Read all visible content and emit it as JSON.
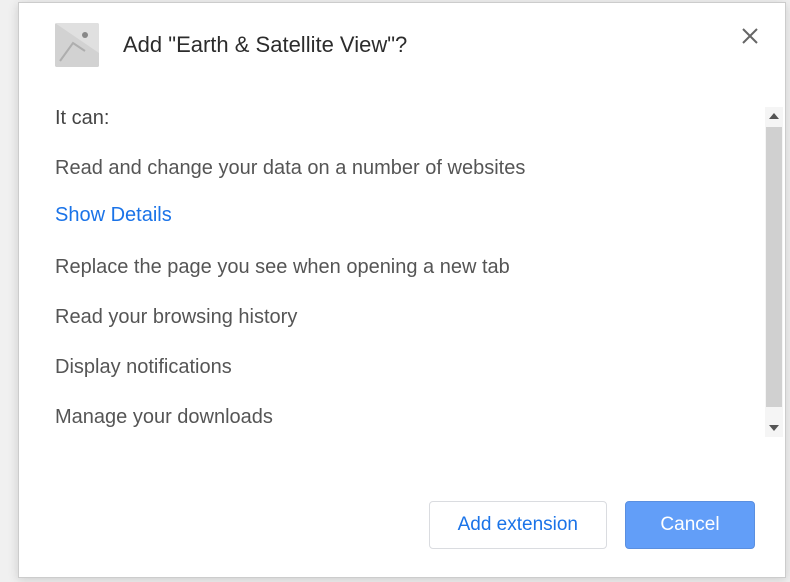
{
  "dialog": {
    "title": "Add \"Earth & Satellite View\"?",
    "permissions_intro": "It can:",
    "permissions": [
      "Read and change your data on a number of websites",
      "Replace the page you see when opening a new tab",
      "Read your browsing history",
      "Display notifications",
      "Manage your downloads"
    ],
    "show_details_label": "Show Details",
    "buttons": {
      "add": "Add extension",
      "cancel": "Cancel"
    }
  }
}
